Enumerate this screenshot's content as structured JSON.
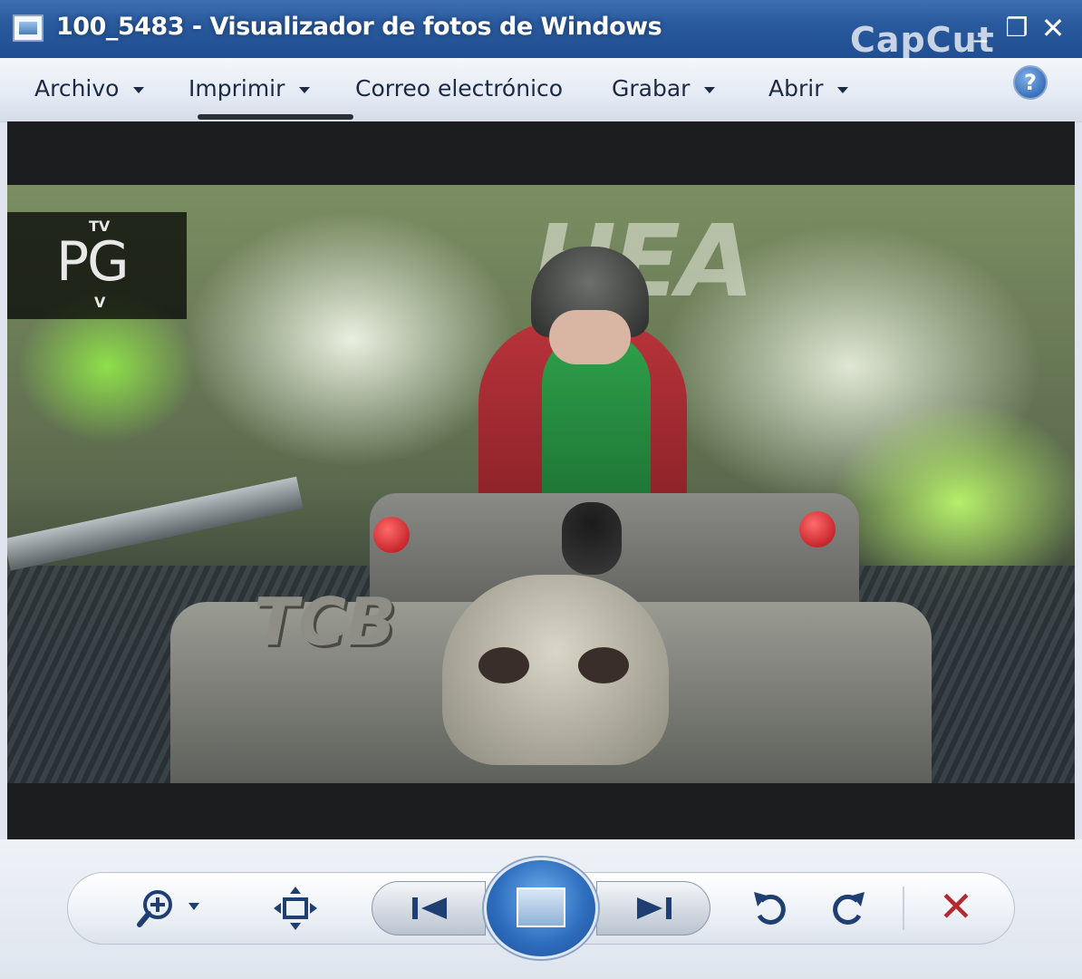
{
  "window": {
    "title": "100_5483 - Visualizador de fotos de Windows",
    "watermark": "CapCut",
    "minimize_glyph": "_",
    "maximize_glyph": "❐",
    "close_glyph": "✕"
  },
  "menu": {
    "items": [
      {
        "label": "Archivo",
        "dropdown": true
      },
      {
        "label": "Imprimir",
        "dropdown": true
      },
      {
        "label": "Correo electrónico",
        "dropdown": false
      },
      {
        "label": "Grabar",
        "dropdown": true
      },
      {
        "label": "Abrir",
        "dropdown": true
      }
    ],
    "help_glyph": "?"
  },
  "photo": {
    "rating_top": "TV",
    "rating_main": "PG",
    "rating_bottom": "V",
    "tank_text": "TCB",
    "background_text": "HEA"
  },
  "toolbar": {
    "zoom_icon": "zoom-icon",
    "fit_icon": "actual-size-icon",
    "prev_icon": "previous-icon",
    "slideshow_icon": "slideshow-icon",
    "next_icon": "next-icon",
    "rotate_left_icon": "rotate-counterclockwise-icon",
    "rotate_right_icon": "rotate-clockwise-icon",
    "delete_glyph": "✕",
    "accent": "#1f3f72",
    "delete_color": "#b4282e"
  }
}
